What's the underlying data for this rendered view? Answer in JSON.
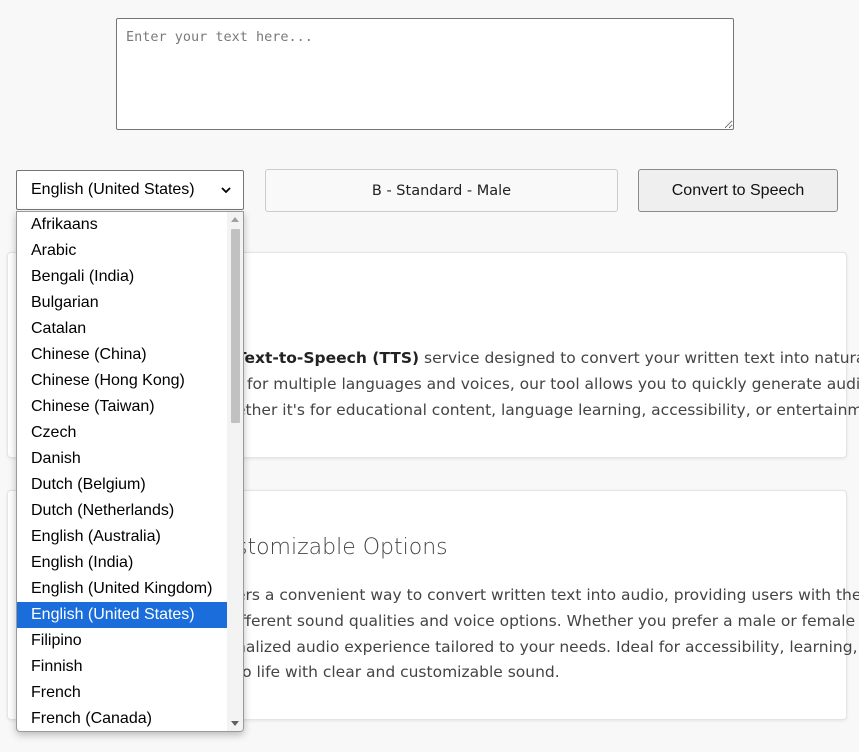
{
  "input": {
    "placeholder": "Enter your text here..."
  },
  "language_select": {
    "value": "English (United States)"
  },
  "voice": {
    "value": "B - Standard - Male"
  },
  "convert_button": {
    "label": "Convert to Speech"
  },
  "card1": {
    "lines": [
      {
        "bold": "Text-to-Speech (TTS)",
        "text": " service designed to convert your written text into natural-"
      },
      {
        "bold": "",
        "text": "t for multiple languages and voices, our tool allows you to quickly generate audio"
      },
      {
        "bold": "",
        "text": "ether it's for educational content, language learning, accessibility, or entertainment."
      }
    ]
  },
  "card2": {
    "title": "stomizable Options",
    "lines": [
      "ers a convenient way to convert written text into audio, providing users with the",
      "ifferent sound qualities and voice options. Whether you prefer a male or female",
      "nalized audio experience tailored to your needs. Ideal for accessibility, learning, or",
      "to life with clear and customizable sound."
    ]
  },
  "language_options": [
    "Afrikaans",
    "Arabic",
    "Bengali (India)",
    "Bulgarian",
    "Catalan",
    "Chinese (China)",
    "Chinese (Hong Kong)",
    "Chinese (Taiwan)",
    "Czech",
    "Danish",
    "Dutch (Belgium)",
    "Dutch (Netherlands)",
    "English (Australia)",
    "English (India)",
    "English (United Kingdom)",
    "English (United States)",
    "Filipino",
    "Finnish",
    "French",
    "French (Canada)"
  ],
  "selected_option_index": 15,
  "colors": {
    "selection": "#1a6dda",
    "background": "#f8f8f8"
  },
  "icons": {
    "select_arrow": "chevron-down-icon",
    "scroll_up": "scroll-up-arrow-icon",
    "scroll_down": "scroll-down-arrow-icon"
  }
}
